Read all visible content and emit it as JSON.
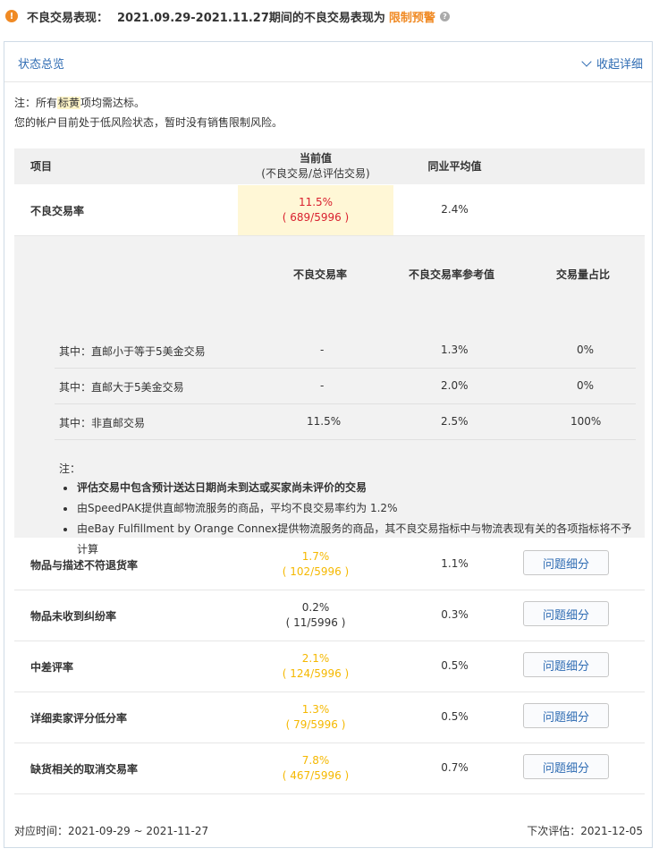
{
  "header": {
    "label": "不良交易表现：",
    "period_text": "2021.09.29-2021.11.27期间的不良交易表现为",
    "status": "限制预警",
    "warn_glyph": "!",
    "help_glyph": "?"
  },
  "panel": {
    "title": "状态总览",
    "collapse_label": "收起详细"
  },
  "notes": {
    "line1_prefix": "注：所有",
    "line1_highlight": "标黄",
    "line1_suffix": "项均需达标。",
    "line2": "您的帐户目前处于低风险状态，暂时没有销售限制风险。"
  },
  "table": {
    "headers": {
      "item": "项目",
      "current": "当前值",
      "current_sub": "(不良交易/总评估交易)",
      "avg": "同业平均值"
    },
    "main_row": {
      "label": "不良交易率",
      "value": "11.5%",
      "ratio": "( 689/5996 )",
      "avg": "2.4%"
    },
    "breakdown": {
      "headers": [
        "不良交易率",
        "不良交易率参考值",
        "交易量占比"
      ],
      "rows": [
        {
          "label": "其中：直邮小于等于5美金交易",
          "rate": "-",
          "ref": "1.3%",
          "share": "0%"
        },
        {
          "label": "其中：直邮大于5美金交易",
          "rate": "-",
          "ref": "2.0%",
          "share": "0%"
        },
        {
          "label": "其中：非直邮交易",
          "rate": "11.5%",
          "ref": "2.5%",
          "share": "100%"
        }
      ],
      "note_title": "注：",
      "notes": [
        "评估交易中包含预计送达日期尚未到达或买家尚未评价的交易",
        "由SpeedPAK提供直邮物流服务的商品，平均不良交易率约为 1.2%",
        "由eBay Fulfillment by Orange Connex提供物流服务的商品，其不良交易指标中与物流表现有关的各项指标将不予计算"
      ]
    },
    "metric_rows": [
      {
        "label": "物品与描述不符退货率",
        "value": "1.7%",
        "ratio": "( 102/5996 )",
        "avg": "1.1%",
        "button": "问题细分",
        "color": "#f5b800"
      },
      {
        "label": "物品未收到纠纷率",
        "value": "0.2%",
        "ratio": "( 11/5996 )",
        "avg": "0.3%",
        "button": "问题细分",
        "color": "#333333"
      },
      {
        "label": "中差评率",
        "value": "2.1%",
        "ratio": "( 124/5996 )",
        "avg": "0.5%",
        "button": "问题细分",
        "color": "#f5b800"
      },
      {
        "label": "详细卖家评分低分率",
        "value": "1.3%",
        "ratio": "( 79/5996 )",
        "avg": "0.5%",
        "button": "问题细分",
        "color": "#f5b800"
      },
      {
        "label": "缺货相关的取消交易率",
        "value": "7.8%",
        "ratio": "( 467/5996 )",
        "avg": "0.7%",
        "button": "问题细分",
        "color": "#f5b800"
      }
    ]
  },
  "footer": {
    "period": "对应时间：2021-09-29 ~ 2021-11-27",
    "next_eval": "下次评估：2021-12-05"
  }
}
